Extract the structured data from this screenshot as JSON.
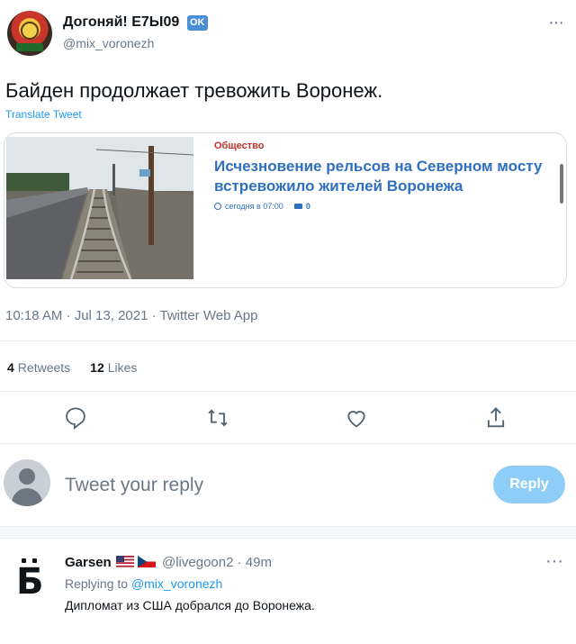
{
  "tweet": {
    "author_name": "Догоняй! Е7Ы09",
    "author_badge": "OK",
    "handle": "@mix_voronezh",
    "text": "Байден продолжает тревожить Воронеж.",
    "translate_label": "Translate Tweet",
    "timestamp": "10:18 AM · Jul 13, 2021 · Twitter Web App",
    "retweets_count": "4",
    "retweets_label": "Retweets",
    "likes_count": "12",
    "likes_label": "Likes"
  },
  "card": {
    "category": "Общество",
    "title": "Исчезновение рельсов на Северном мосту встревожило жителей Воронежа",
    "time": "сегодня в 07:00",
    "comments": "0"
  },
  "actions": [
    "reply-icon",
    "retweet-icon",
    "like-icon",
    "share-icon"
  ],
  "composer": {
    "placeholder": "Tweet your reply",
    "button_label": "Reply"
  },
  "reply": {
    "name": "Garsen",
    "handle": "@livegoon2 · 49m",
    "replying_prefix": "Replying to",
    "replying_to": "@mix_voronezh",
    "text": "Дипломат из США добрался до Воронежа."
  },
  "colors": {
    "accent": "#1d9bf0",
    "reply_button": "#8ecdf8",
    "card_title": "#2f6fbf",
    "category": "#c4302b"
  }
}
